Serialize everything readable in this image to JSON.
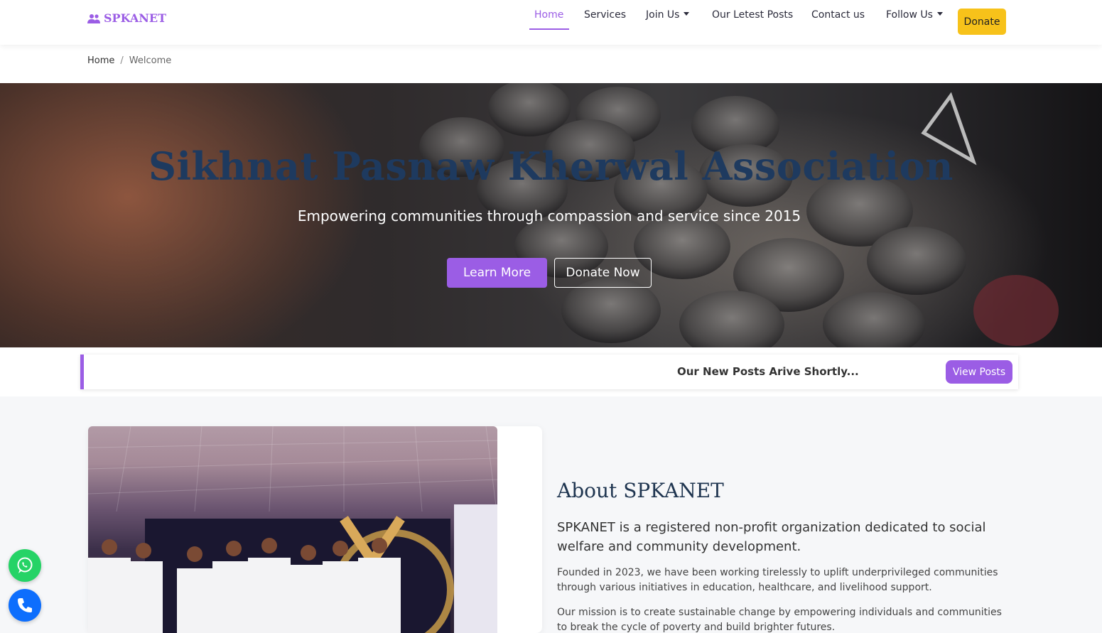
{
  "brand": {
    "name": "SPKANET",
    "icon": "users-icon"
  },
  "nav": {
    "items": [
      {
        "label": "Home",
        "active": true
      },
      {
        "label": "Services"
      },
      {
        "label": "Join Us",
        "dropdown": true
      },
      {
        "label": "Our Letest Posts"
      },
      {
        "label": "Contact us"
      },
      {
        "label": "Follow Us",
        "dropdown": true
      }
    ],
    "donate_label": "Donate"
  },
  "breadcrumb": {
    "home": "Home",
    "separator": "/",
    "current": "Welcome"
  },
  "hero": {
    "title": "Sikhnat Pasnaw Kherwal Association",
    "subtitle": "Empowering communities through compassion and service since 2015",
    "learn_more": "Learn More",
    "donate_now": "Donate Now"
  },
  "ticker": {
    "text": "Our New Posts Arive Shortly...",
    "button": "View Posts"
  },
  "about": {
    "title": "About SPKANET",
    "lead": "SPKANET is a registered non-profit organization dedicated to social welfare and community development.",
    "p1": "Founded in 2023, we have been working tirelessly to uplift underprivileged communities through various initiatives in education, healthcare, and livelihood support.",
    "p2": "Our mission is to create sustainable change by empowering individuals and communities to break the cycle of poverty and build brighter futures."
  },
  "floating": {
    "whatsapp_icon": "whatsapp-icon",
    "phone_icon": "phone-icon"
  },
  "colors": {
    "accent": "#9b5de5",
    "donate": "#f7c21a",
    "hero_title": "#1e3a5f",
    "whatsapp": "#25d366",
    "phone": "#0d6efd"
  }
}
